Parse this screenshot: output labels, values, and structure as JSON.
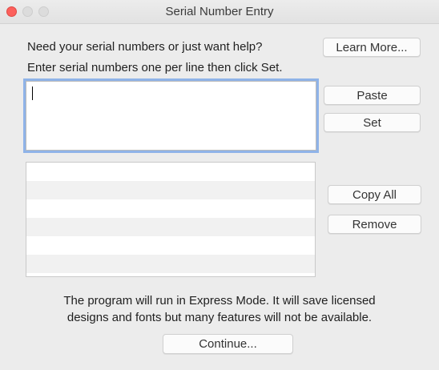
{
  "window": {
    "title": "Serial Number Entry"
  },
  "intro": {
    "help_text": "Need your serial numbers or just want help?",
    "instructions": "Enter serial numbers one per line then click Set."
  },
  "buttons": {
    "learn_more": "Learn More...",
    "paste": "Paste",
    "set": "Set",
    "copy_all": "Copy All",
    "remove": "Remove",
    "continue": "Continue..."
  },
  "serial_input": {
    "value": ""
  },
  "serial_list": {
    "items": [
      "",
      "",
      "",
      "",
      "",
      ""
    ]
  },
  "notice": {
    "line1": "The program will run in Express Mode. It will save licensed",
    "line2": "designs and fonts but many features will not be available."
  },
  "colors": {
    "close_button": "#fc605c",
    "focus_ring": "#8fb3e8",
    "window_background": "#ececec"
  }
}
